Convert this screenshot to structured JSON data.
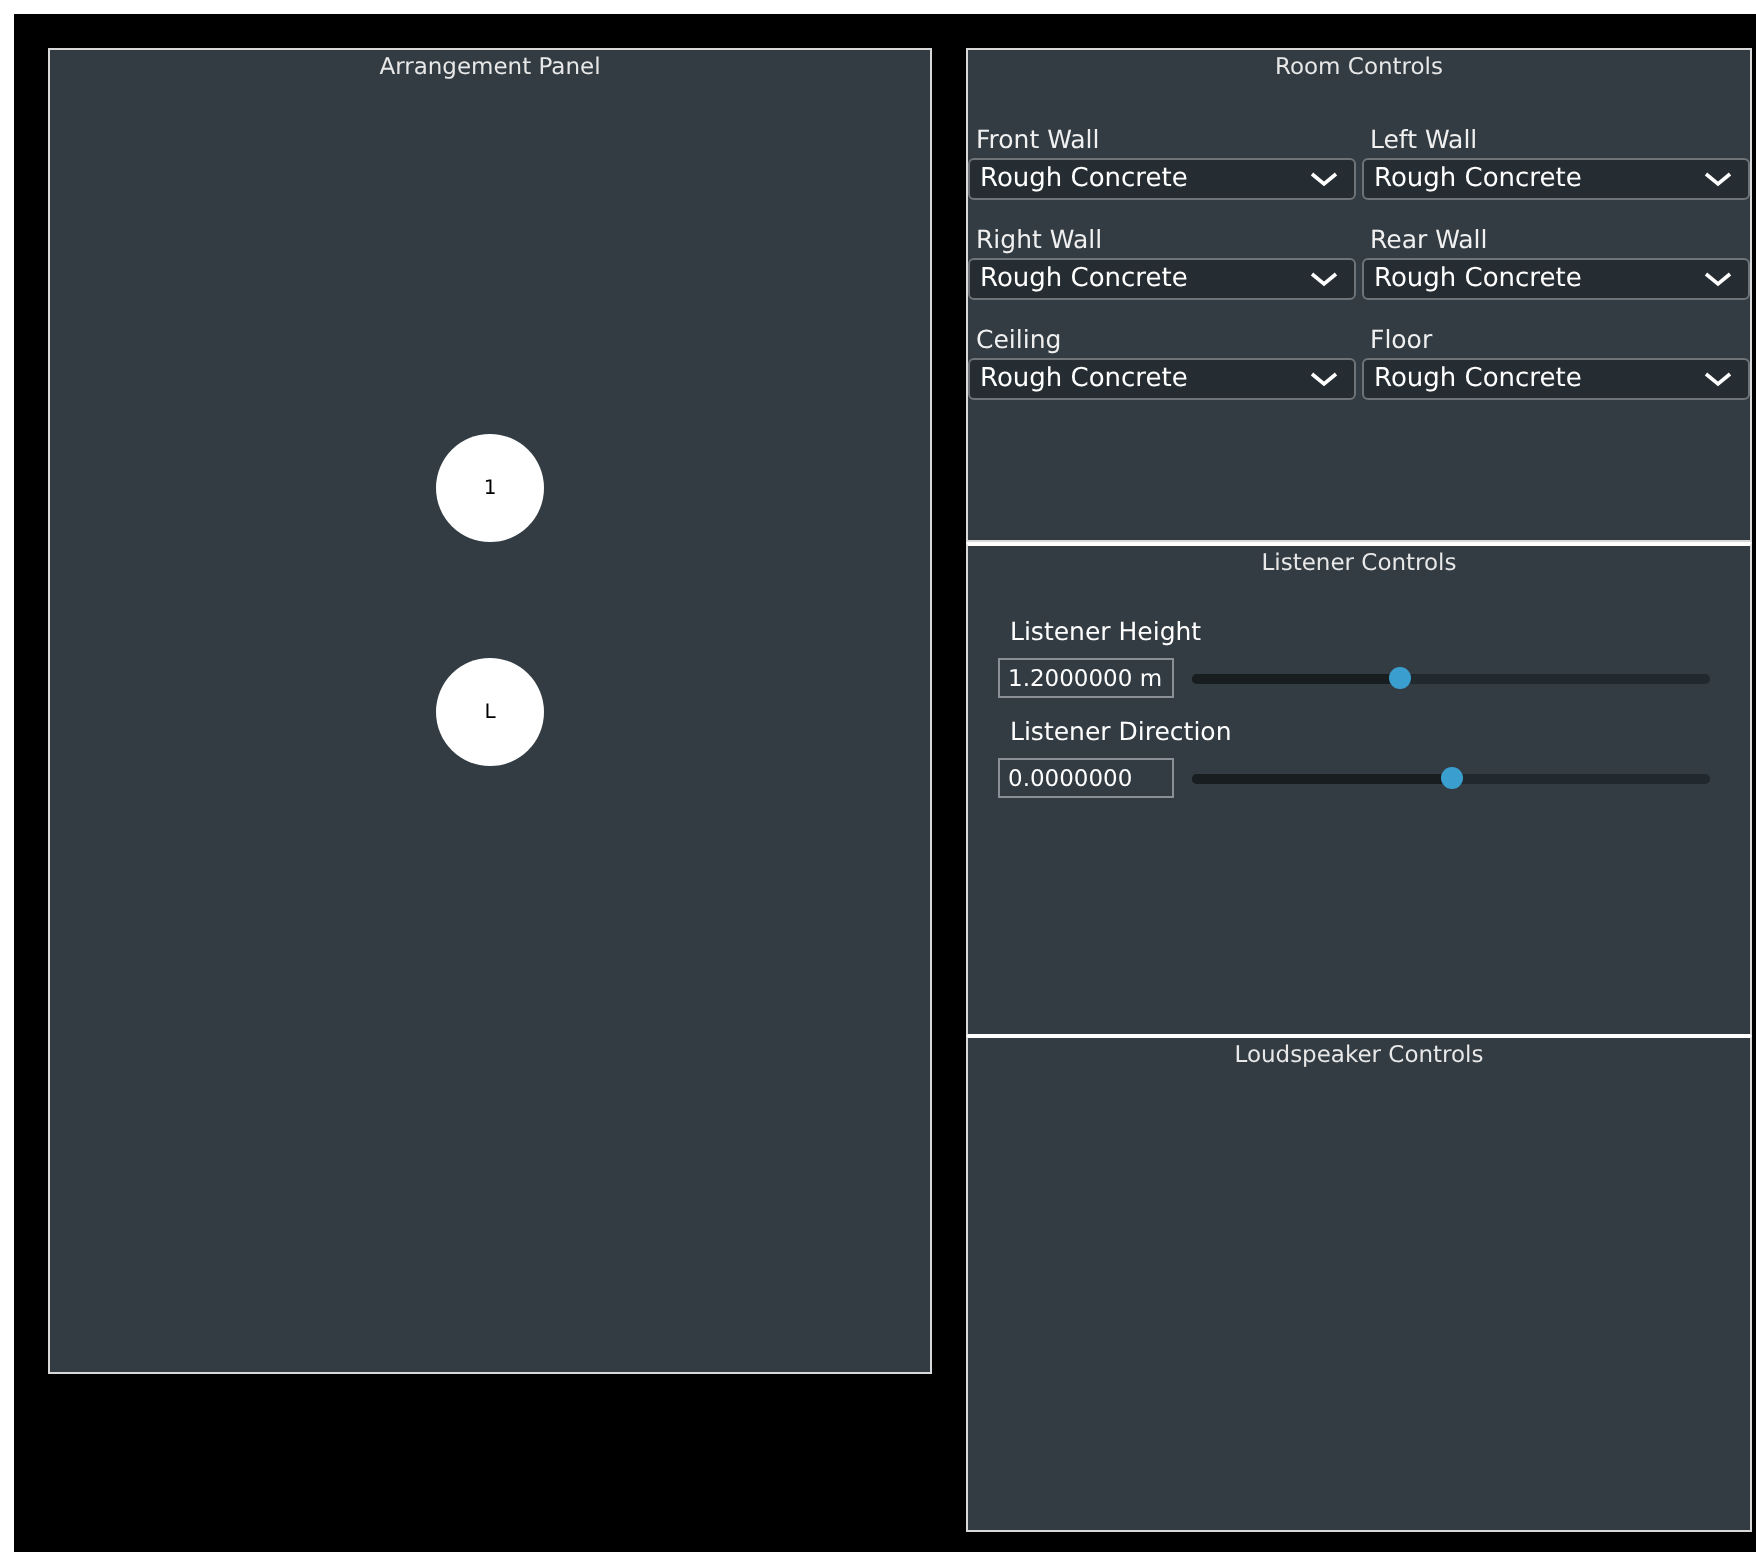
{
  "arrangement_panel": {
    "title": "Arrangement Panel",
    "nodes": [
      {
        "kind": "speaker",
        "label": "1"
      },
      {
        "kind": "listener",
        "label": "L"
      }
    ]
  },
  "room_controls": {
    "title": "Room Controls",
    "surfaces": [
      {
        "label": "Front Wall",
        "value": "Rough Concrete"
      },
      {
        "label": "Left Wall",
        "value": "Rough Concrete"
      },
      {
        "label": "Right Wall",
        "value": "Rough Concrete"
      },
      {
        "label": "Rear Wall",
        "value": "Rough Concrete"
      },
      {
        "label": "Ceiling",
        "value": "Rough Concrete"
      },
      {
        "label": "Floor",
        "value": "Rough Concrete"
      }
    ]
  },
  "listener_controls": {
    "title": "Listener Controls",
    "sliders": [
      {
        "label": "Listener Height",
        "value": "1.2000000 m",
        "level": 0.4
      },
      {
        "label": "Listener Direction",
        "value": "0.0000000",
        "level": 0.5
      }
    ]
  },
  "loudspeaker_controls": {
    "title": "Loudspeaker Controls"
  }
}
